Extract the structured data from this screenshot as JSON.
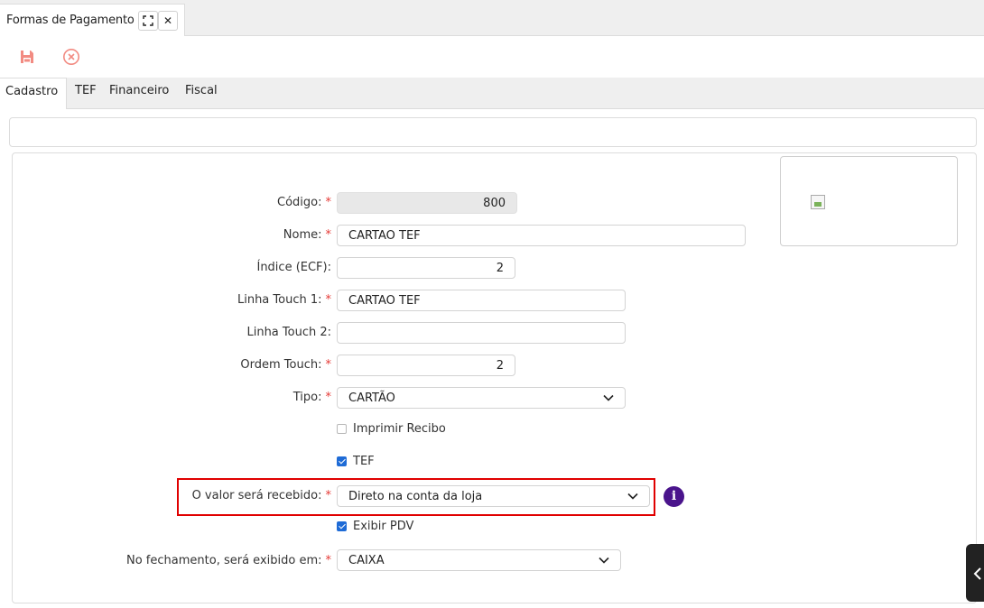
{
  "window_tab": {
    "title": "Formas de Pagamento",
    "expand_icon": "expand-icon",
    "close_label": "✕"
  },
  "toolbar": {
    "save_icon": "floppy-disk-icon",
    "cancel_icon": "circle-x-icon",
    "icon_color": "#f28b82"
  },
  "tabs": [
    {
      "label": "Cadastro",
      "active": true
    },
    {
      "label": "TEF",
      "active": false
    },
    {
      "label": "Financeiro",
      "active": false
    },
    {
      "label": "Fiscal",
      "active": false
    }
  ],
  "form": {
    "codigo": {
      "label": "Código:",
      "value": "800",
      "required": true
    },
    "nome": {
      "label": "Nome:",
      "value": "CARTAO TEF",
      "required": true
    },
    "indice": {
      "label": "Índice (ECF):",
      "value": "2",
      "required": false
    },
    "linha1": {
      "label": "Linha Touch 1:",
      "value": "CARTAO TEF",
      "required": true
    },
    "linha2": {
      "label": "Linha Touch 2:",
      "value": "",
      "required": false
    },
    "ordem": {
      "label": "Ordem Touch:",
      "value": "2",
      "required": true
    },
    "tipo": {
      "label": "Tipo:",
      "value": "CARTÃO",
      "required": true
    },
    "imprimir": {
      "label": "Imprimir Recibo",
      "checked": false
    },
    "tef": {
      "label": "TEF",
      "checked": true
    },
    "recebido": {
      "label": "O valor será recebido:",
      "value": "Direto na conta da loja",
      "required": true
    },
    "exibir": {
      "label": "Exibir PDV",
      "checked": true
    },
    "fechamento": {
      "label": "No fechamento, será exibido em:",
      "value": "CAIXA",
      "required": true
    },
    "req_mark": "*"
  },
  "info_icon": "i",
  "colors": {
    "highlight": "#e00000",
    "info": "#4a148c",
    "checkbox": "#1e6bd6",
    "required": "#e53935"
  }
}
